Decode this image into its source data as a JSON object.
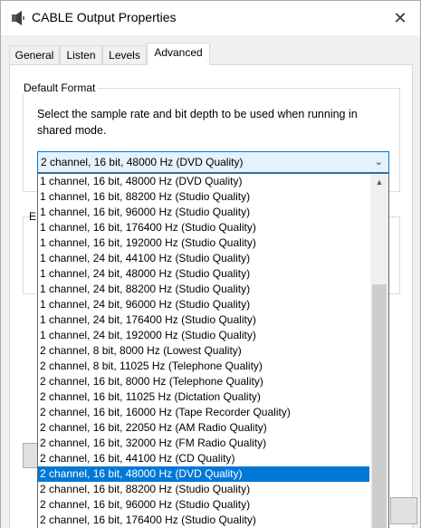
{
  "window": {
    "title": "CABLE Output Properties",
    "close_glyph": "✕"
  },
  "tabs": [
    {
      "label": "General"
    },
    {
      "label": "Listen"
    },
    {
      "label": "Levels"
    },
    {
      "label": "Advanced",
      "active": true
    }
  ],
  "default_format": {
    "group_title": "Default Format",
    "description": "Select the sample rate and bit depth to be used when running in shared mode.",
    "selected_value": "2 channel, 16 bit, 48000 Hz (DVD Quality)",
    "arrow": "⌄"
  },
  "obscured_group_letter": "E",
  "dropdown": {
    "options": [
      "1 channel, 16 bit, 48000 Hz (DVD Quality)",
      "1 channel, 16 bit, 88200 Hz (Studio Quality)",
      "1 channel, 16 bit, 96000 Hz (Studio Quality)",
      "1 channel, 16 bit, 176400 Hz (Studio Quality)",
      "1 channel, 16 bit, 192000 Hz (Studio Quality)",
      "1 channel, 24 bit, 44100 Hz (Studio Quality)",
      "1 channel, 24 bit, 48000 Hz (Studio Quality)",
      "1 channel, 24 bit, 88200 Hz (Studio Quality)",
      "1 channel, 24 bit, 96000 Hz (Studio Quality)",
      "1 channel, 24 bit, 176400 Hz (Studio Quality)",
      "1 channel, 24 bit, 192000 Hz (Studio Quality)",
      "2 channel, 8 bit, 8000 Hz (Lowest Quality)",
      "2 channel, 8 bit, 11025 Hz (Telephone Quality)",
      "2 channel, 16 bit, 8000 Hz (Telephone Quality)",
      "2 channel, 16 bit, 11025 Hz (Dictation Quality)",
      "2 channel, 16 bit, 16000 Hz (Tape Recorder Quality)",
      "2 channel, 16 bit, 22050 Hz (AM Radio Quality)",
      "2 channel, 16 bit, 32000 Hz (FM Radio Quality)",
      "2 channel, 16 bit, 44100 Hz (CD Quality)",
      "2 channel, 16 bit, 48000 Hz (DVD Quality)",
      "2 channel, 16 bit, 88200 Hz (Studio Quality)",
      "2 channel, 16 bit, 96000 Hz (Studio Quality)",
      "2 channel, 16 bit, 176400 Hz (Studio Quality)"
    ],
    "selected_index": 19,
    "scroll_up_glyph": "▲"
  },
  "colors": {
    "selection": "#0078d7",
    "combo_bg": "#e5f1fb"
  }
}
